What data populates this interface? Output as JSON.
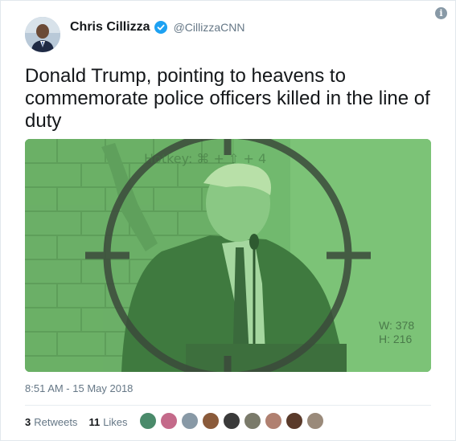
{
  "tweet": {
    "author_name": "Chris Cillizza",
    "author_handle": "@CillizzaCNN",
    "text": "Donald Trump, pointing to heavens to commemorate police officers killed in the line of duty",
    "timestamp": "8:51 AM - 15 May 2018",
    "retweets_count": "3",
    "retweets_label": "Retweets",
    "likes_count": "11",
    "likes_label": "Likes"
  },
  "media": {
    "overlay_hotkey_text": "Hotkey: ⌘ + ⇧ + 4",
    "overlay_width_text": "W: 378",
    "overlay_height_text": "H: 216",
    "tint_color": "#6fb86d"
  },
  "likers": [
    {
      "color": "#4a8a6a"
    },
    {
      "color": "#c46a8a"
    },
    {
      "color": "#8899a6"
    },
    {
      "color": "#8a5a3a"
    },
    {
      "color": "#3a3a3a"
    },
    {
      "color": "#7a7a6a"
    },
    {
      "color": "#b08070"
    },
    {
      "color": "#5a3a2a"
    },
    {
      "color": "#9a8a7a"
    }
  ],
  "icons": [
    "info-icon",
    "verified-badge-icon",
    "avatar-photo",
    "crosshair-overlay"
  ]
}
